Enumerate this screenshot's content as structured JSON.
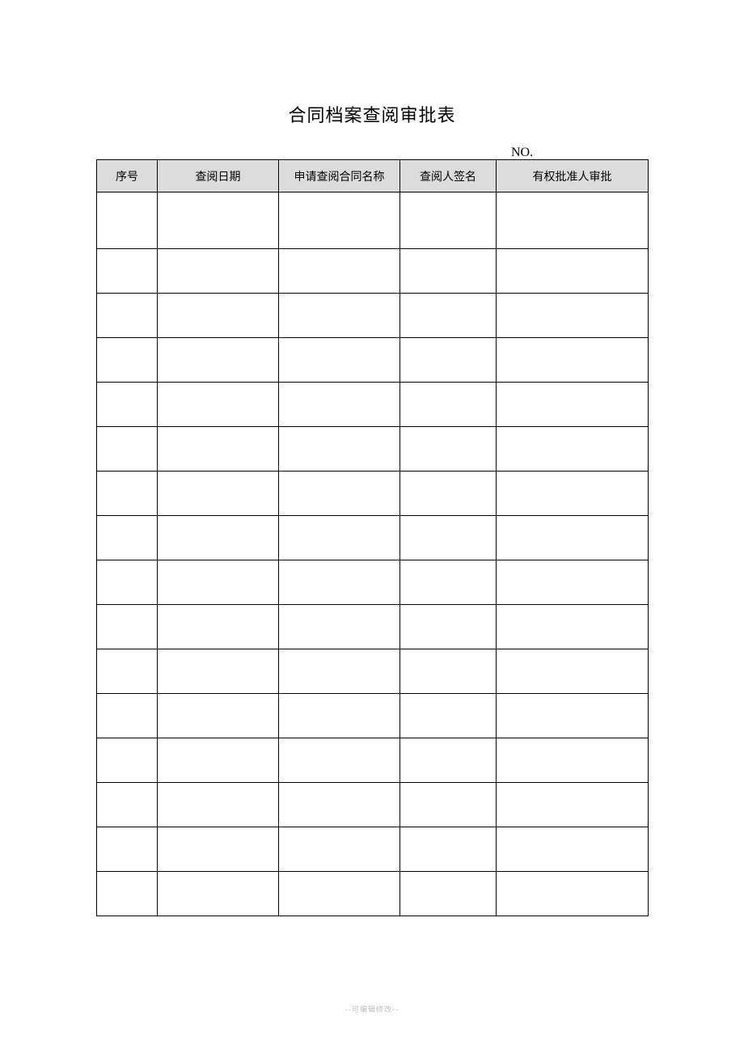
{
  "title": "合同档案查阅审批表",
  "no_label": "NO.",
  "headers": {
    "col1": "序号",
    "col2": "查阅日期",
    "col3": "申请查阅合同名称",
    "col4": "查阅人签名",
    "col5": "有权批准人审批"
  },
  "rows": [
    {
      "c1": "",
      "c2": "",
      "c3": "",
      "c4": "",
      "c5": ""
    },
    {
      "c1": "",
      "c2": "",
      "c3": "",
      "c4": "",
      "c5": ""
    },
    {
      "c1": "",
      "c2": "",
      "c3": "",
      "c4": "",
      "c5": ""
    },
    {
      "c1": "",
      "c2": "",
      "c3": "",
      "c4": "",
      "c5": ""
    },
    {
      "c1": "",
      "c2": "",
      "c3": "",
      "c4": "",
      "c5": ""
    },
    {
      "c1": "",
      "c2": "",
      "c3": "",
      "c4": "",
      "c5": ""
    },
    {
      "c1": "",
      "c2": "",
      "c3": "",
      "c4": "",
      "c5": ""
    },
    {
      "c1": "",
      "c2": "",
      "c3": "",
      "c4": "",
      "c5": ""
    },
    {
      "c1": "",
      "c2": "",
      "c3": "",
      "c4": "",
      "c5": ""
    },
    {
      "c1": "",
      "c2": "",
      "c3": "",
      "c4": "",
      "c5": ""
    },
    {
      "c1": "",
      "c2": "",
      "c3": "",
      "c4": "",
      "c5": ""
    },
    {
      "c1": "",
      "c2": "",
      "c3": "",
      "c4": "",
      "c5": ""
    },
    {
      "c1": "",
      "c2": "",
      "c3": "",
      "c4": "",
      "c5": ""
    },
    {
      "c1": "",
      "c2": "",
      "c3": "",
      "c4": "",
      "c5": ""
    },
    {
      "c1": "",
      "c2": "",
      "c3": "",
      "c4": "",
      "c5": ""
    },
    {
      "c1": "",
      "c2": "",
      "c3": "",
      "c4": "",
      "c5": ""
    }
  ],
  "footer": "--可编辑修改--"
}
